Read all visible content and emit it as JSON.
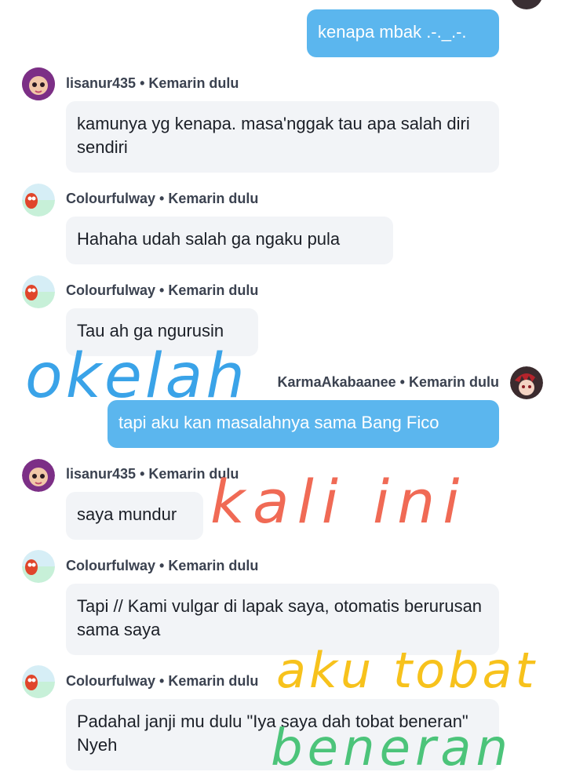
{
  "messages": [
    {
      "mine": true,
      "text": "kenapa mbak .-._.-."
    },
    {
      "user": "lisanur435",
      "time": "Kemarin dulu",
      "text": "kamunya yg kenapa. masa'nggak tau apa salah diri sendiri"
    },
    {
      "user": "Colourfulway",
      "time": "Kemarin dulu",
      "text": "Hahaha udah salah ga ngaku pula"
    },
    {
      "user": "Colourfulway",
      "time": "Kemarin dulu",
      "text": "Tau ah ga ngurusin"
    },
    {
      "mine": true,
      "user": "KarmaAkabaanee",
      "time": "Kemarin dulu",
      "text": "tapi aku kan masalahnya sama Bang Fico"
    },
    {
      "user": "lisanur435",
      "time": "Kemarin dulu",
      "text": "saya mundur"
    },
    {
      "user": "Colourfulway",
      "time": "Kemarin dulu",
      "text": "Tapi // Kami vulgar di lapak saya, otomatis berurusan sama saya"
    },
    {
      "user": "Colourfulway",
      "time": "Kemarin dulu",
      "text": "Padahal janji mu dulu \"Iya saya dah tobat beneran\" Nyeh"
    }
  ],
  "separator": "•",
  "handwriting": {
    "blue": "okelah",
    "red": "kali ini",
    "yellow": "aku tobat",
    "green": "beneran",
    "colors": {
      "blue": "#3aa3e8",
      "red": "#f06a55",
      "yellow": "#f7c21c",
      "green": "#4cc47a"
    }
  }
}
